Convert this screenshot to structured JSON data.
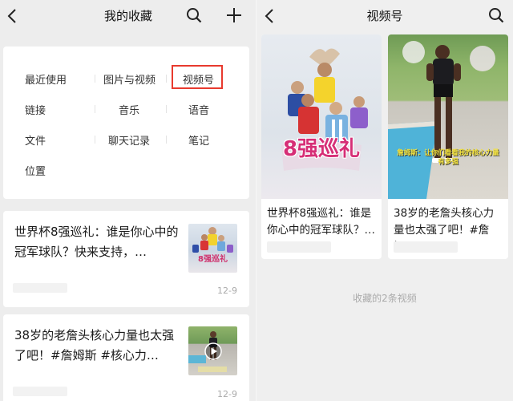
{
  "left": {
    "title": "我的收藏",
    "categories": [
      "最近使用",
      "图片与视频",
      "视频号",
      "链接",
      "音乐",
      "语音",
      "文件",
      "聊天记录",
      "笔记",
      "位置"
    ],
    "items": [
      {
        "title": "世界杯8强巡礼：谁是你心中的冠军球队？快来支持，…",
        "date": "12-9",
        "thumb_text": "8强巡礼"
      },
      {
        "title": "38岁的老詹头核心力量也太强了吧！#詹姆斯 #核心力…",
        "date": "12-9"
      }
    ]
  },
  "right": {
    "title": "视频号",
    "cards": [
      {
        "title": "世界杯8强巡礼：谁是你心中的冠军球队？…",
        "cover_text": "8强巡礼"
      },
      {
        "title": "38岁的老詹头核心力量也太强了吧！#詹姆…",
        "cover_text": "詹姆斯：让你们看看我的核心力量有多强"
      }
    ],
    "count_label": "收藏的2条视频"
  },
  "colors": {
    "highlight": "#e83a2e",
    "background": "#ededed",
    "card": "#ffffff"
  },
  "icons": [
    "back-icon",
    "search-icon",
    "plus-icon",
    "play-icon"
  ]
}
